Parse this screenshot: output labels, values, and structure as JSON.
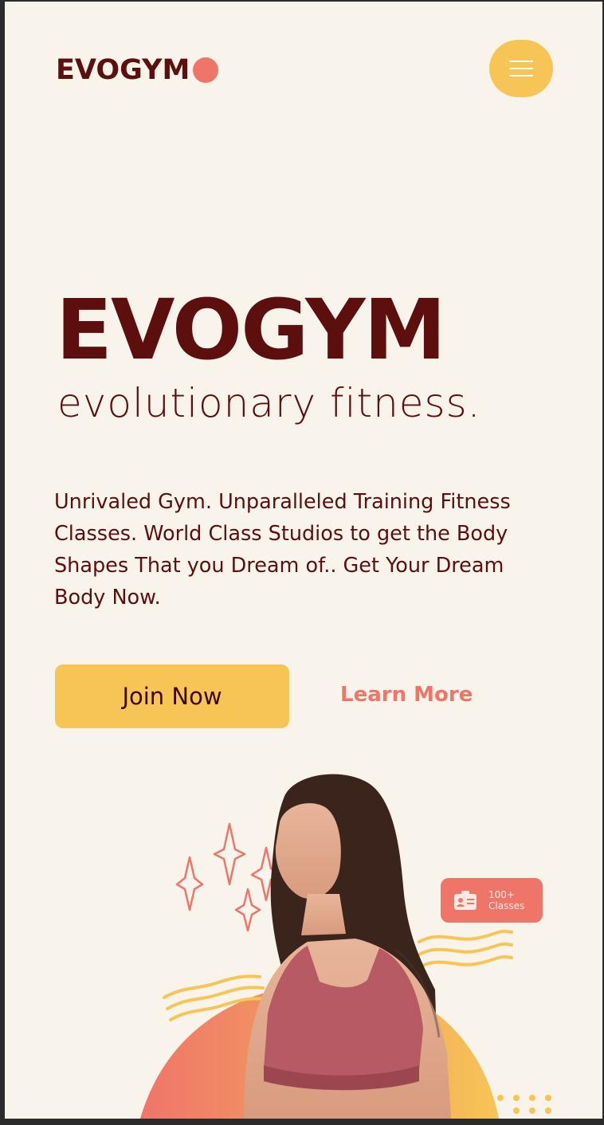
{
  "header": {
    "logo_text": "EVOGYM",
    "menu_icon": "hamburger-icon"
  },
  "hero": {
    "title": "EVOGYM",
    "subtitle": "evolutionary fitness.",
    "description": "Unrivaled Gym. Unparalleled Training Fitness Classes. World Class Studios to get the Body Shapes That you Dream of.. Get Your Dream Body Now.",
    "join_label": "Join Now",
    "learn_label": "Learn More"
  },
  "badge": {
    "icon": "id-card-icon",
    "line1": "100+",
    "line2": "Classes"
  },
  "colors": {
    "background": "#f8f4eb",
    "primary_text": "#5c0f0c",
    "accent_yellow": "#f6c555",
    "accent_coral": "#ef7569"
  }
}
